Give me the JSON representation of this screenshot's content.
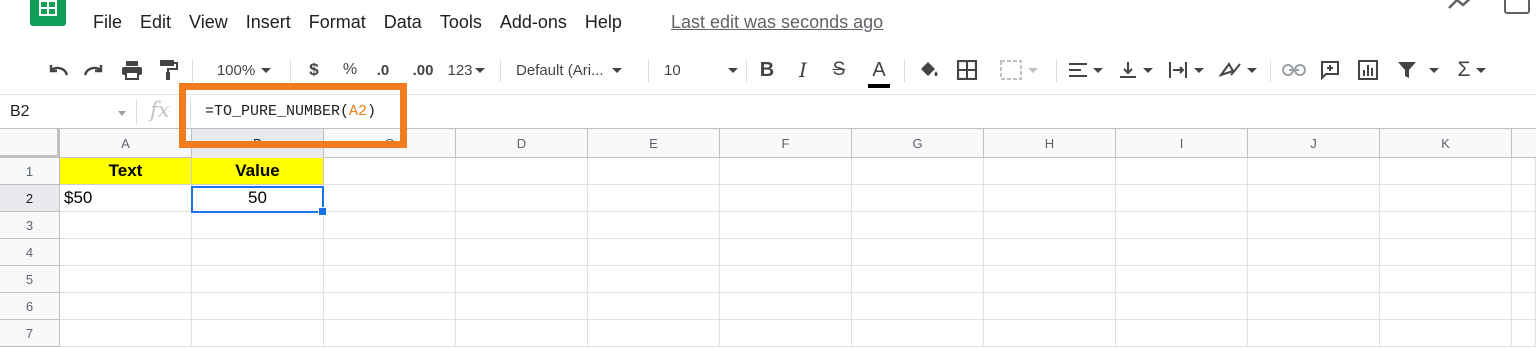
{
  "menu": {
    "items": [
      "File",
      "Edit",
      "View",
      "Insert",
      "Format",
      "Data",
      "Tools",
      "Add-ons",
      "Help"
    ],
    "last_edit": "Last edit was seconds ago"
  },
  "toolbar": {
    "zoom": "100%",
    "currency": "$",
    "percent": "%",
    "decrease_decimal": ".0",
    "increase_decimal": ".00",
    "more_formats": "123",
    "font": "Default (Ari...",
    "font_size": "10",
    "bold": "B",
    "italic": "I",
    "strikethrough": "S",
    "text_color": "A",
    "sum": "Σ"
  },
  "formula_bar": {
    "name_box": "B2",
    "fx": "fx",
    "formula_prefix": "=TO_PURE_NUMBER(",
    "formula_ref": "A2",
    "formula_suffix": ")"
  },
  "grid": {
    "columns": [
      "A",
      "B",
      "C",
      "D",
      "E",
      "F",
      "G",
      "H",
      "I",
      "J",
      "K"
    ],
    "rows": [
      "1",
      "2",
      "3",
      "4",
      "5",
      "6",
      "7"
    ],
    "cells": {
      "A1": "Text",
      "B1": "Value",
      "A2": "$50",
      "B2": "50"
    }
  },
  "colors": {
    "highlight_box": "#f47c20",
    "header_fill": "#ffff00",
    "selection": "#1a73e8",
    "formula_ref": "#e67c12",
    "logo": "#0f9d58"
  }
}
